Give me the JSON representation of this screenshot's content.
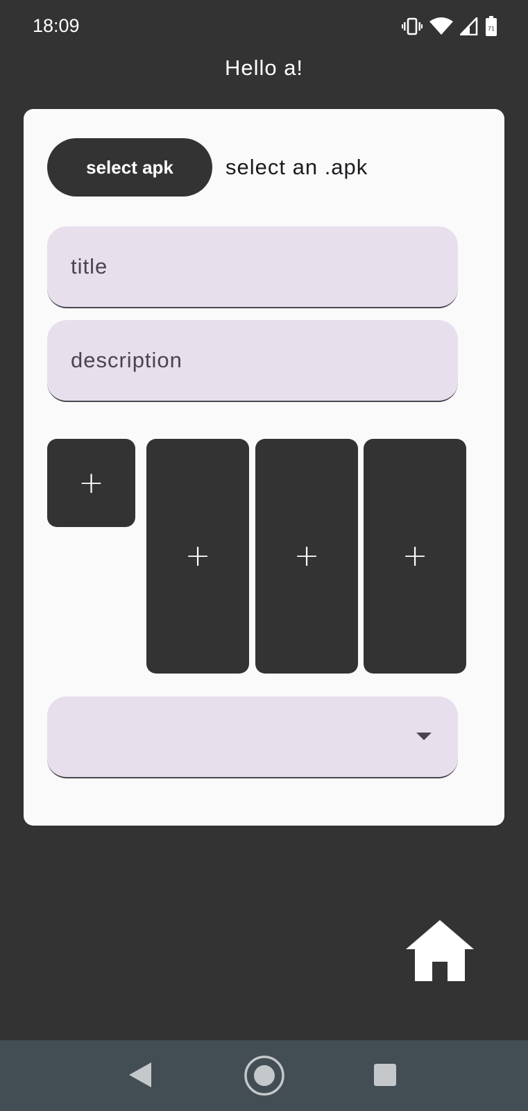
{
  "status_bar": {
    "time": "18:09",
    "battery_level": "71",
    "icons": [
      "vibrate-icon",
      "wifi-icon",
      "cell-signal-icon",
      "battery-icon"
    ]
  },
  "header": {
    "greeting": "Hello a!"
  },
  "form": {
    "select_apk_label": "select apk",
    "select_apk_hint": "select an .apk",
    "title_placeholder": "title",
    "description_placeholder": "description",
    "image_slots": {
      "icon_label": "+",
      "screenshot_labels": [
        "+",
        "+",
        "+"
      ]
    },
    "dropdown_value": ""
  },
  "fab": {
    "icon": "home-icon"
  },
  "nav_bar": {
    "icons": [
      "back-icon",
      "home-circle-icon",
      "recents-icon"
    ]
  },
  "colors": {
    "background": "#333333",
    "card": "#fafafa",
    "field": "#e7dfec",
    "nav_bar": "#434d54"
  }
}
